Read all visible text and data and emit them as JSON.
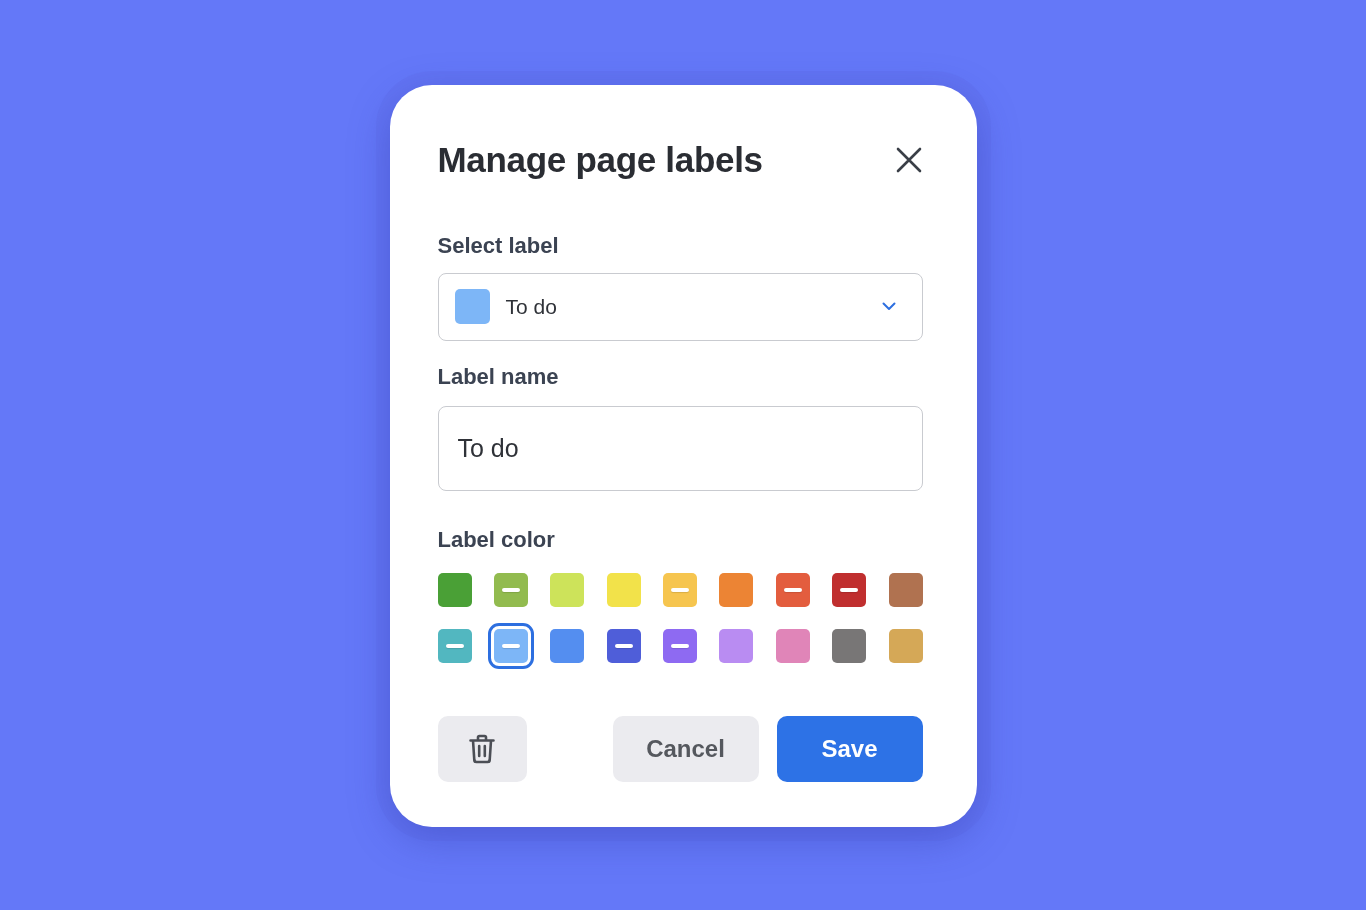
{
  "dialog": {
    "title": "Manage page labels"
  },
  "select_label": {
    "label": "Select label",
    "value": "To do",
    "color": "#7db6f7"
  },
  "label_name": {
    "label": "Label name",
    "value": "To do"
  },
  "label_color": {
    "label": "Label color",
    "swatches": [
      {
        "color": "#4aa036",
        "used": false,
        "selected": false
      },
      {
        "color": "#92bb4f",
        "used": true,
        "selected": false
      },
      {
        "color": "#cde35a",
        "used": false,
        "selected": false
      },
      {
        "color": "#f2e24a",
        "used": false,
        "selected": false
      },
      {
        "color": "#f6c54f",
        "used": true,
        "selected": false
      },
      {
        "color": "#ec8434",
        "used": false,
        "selected": false
      },
      {
        "color": "#e35d3e",
        "used": true,
        "selected": false
      },
      {
        "color": "#c02f2f",
        "used": true,
        "selected": false
      },
      {
        "color": "#b07250",
        "used": false,
        "selected": false
      },
      {
        "color": "#52b7c0",
        "used": true,
        "selected": false
      },
      {
        "color": "#7db6f7",
        "used": true,
        "selected": true
      },
      {
        "color": "#548ef0",
        "used": false,
        "selected": false
      },
      {
        "color": "#4f5ed9",
        "used": true,
        "selected": false
      },
      {
        "color": "#8e6af2",
        "used": true,
        "selected": false
      },
      {
        "color": "#b98cf2",
        "used": false,
        "selected": false
      },
      {
        "color": "#e085b8",
        "used": false,
        "selected": false
      },
      {
        "color": "#787676",
        "used": false,
        "selected": false
      },
      {
        "color": "#d5a857",
        "used": false,
        "selected": false
      }
    ]
  },
  "buttons": [
    {
      "kind": "delete"
    },
    {
      "kind": "secondary",
      "label": "Cancel"
    },
    {
      "kind": "primary",
      "label": "Save"
    }
  ]
}
